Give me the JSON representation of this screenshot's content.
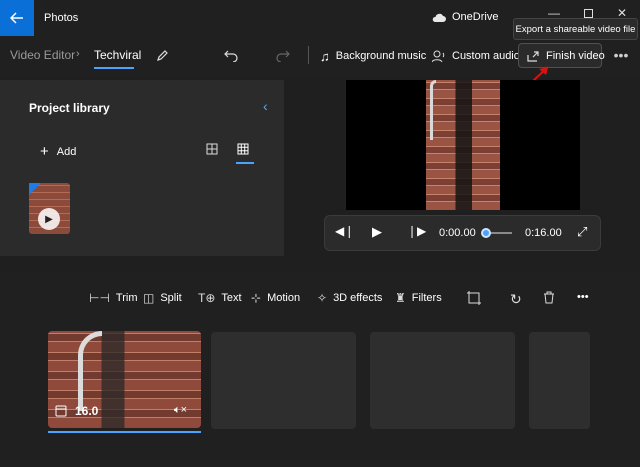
{
  "titlebar": {
    "app_title": "Photos",
    "onedrive_label": "OneDrive"
  },
  "tooltip": {
    "text": "Export a shareable video file"
  },
  "breadcrumb": {
    "root": "Video Editor",
    "current": "Techviral"
  },
  "toolbar": {
    "background_music": "Background music",
    "custom_audio": "Custom audio",
    "finish_video": "Finish video"
  },
  "library": {
    "title": "Project library",
    "add_label": "Add"
  },
  "player": {
    "current_time": "0:00.00",
    "total_time": "0:16.00",
    "progress": 0.0
  },
  "timeline_tools": {
    "trim": "Trim",
    "split": "Split",
    "text": "Text",
    "motion": "Motion",
    "effects_3d": "3D effects",
    "filters": "Filters"
  },
  "storyboard": {
    "clip_duration": "16.0"
  },
  "colors": {
    "accent": "#4aa3ff",
    "titlebar_back": "#0a6fd6",
    "annotation_arrow": "#e01010"
  }
}
